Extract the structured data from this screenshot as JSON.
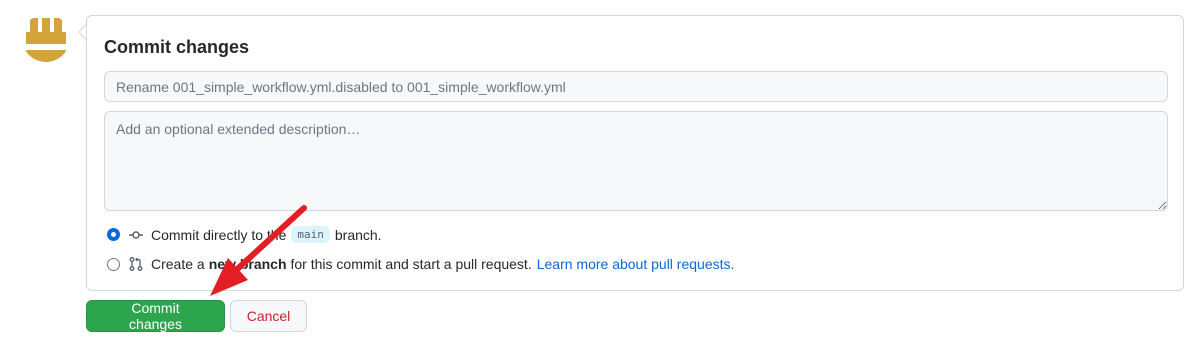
{
  "avatar": {
    "name": "avatar",
    "icon": "identicon"
  },
  "form": {
    "title": "Commit changes",
    "summary_value": "",
    "summary_placeholder": "Rename 001_simple_workflow.yml.disabled to 001_simple_workflow.yml",
    "description_value": "",
    "description_placeholder": "Add an optional extended description…"
  },
  "options": {
    "direct": {
      "checked": true,
      "icon": "git-commit-icon",
      "text_before": "Commit directly to the",
      "branch": "main",
      "text_after": "branch."
    },
    "new_branch": {
      "checked": false,
      "icon": "git-pull-request-icon",
      "text_before": "Create a",
      "bold": "new branch",
      "text_after": "for this commit and start a pull request.",
      "link": "Learn more about pull requests."
    }
  },
  "buttons": {
    "commit": "Commit changes",
    "cancel": "Cancel"
  },
  "colors": {
    "primary_button": "#2da44e",
    "cancel_text": "#cf222e",
    "link": "#0969da",
    "radio_checked": "#0969da",
    "annotation_arrow": "#e31e24",
    "avatar": "#d4a33c"
  }
}
